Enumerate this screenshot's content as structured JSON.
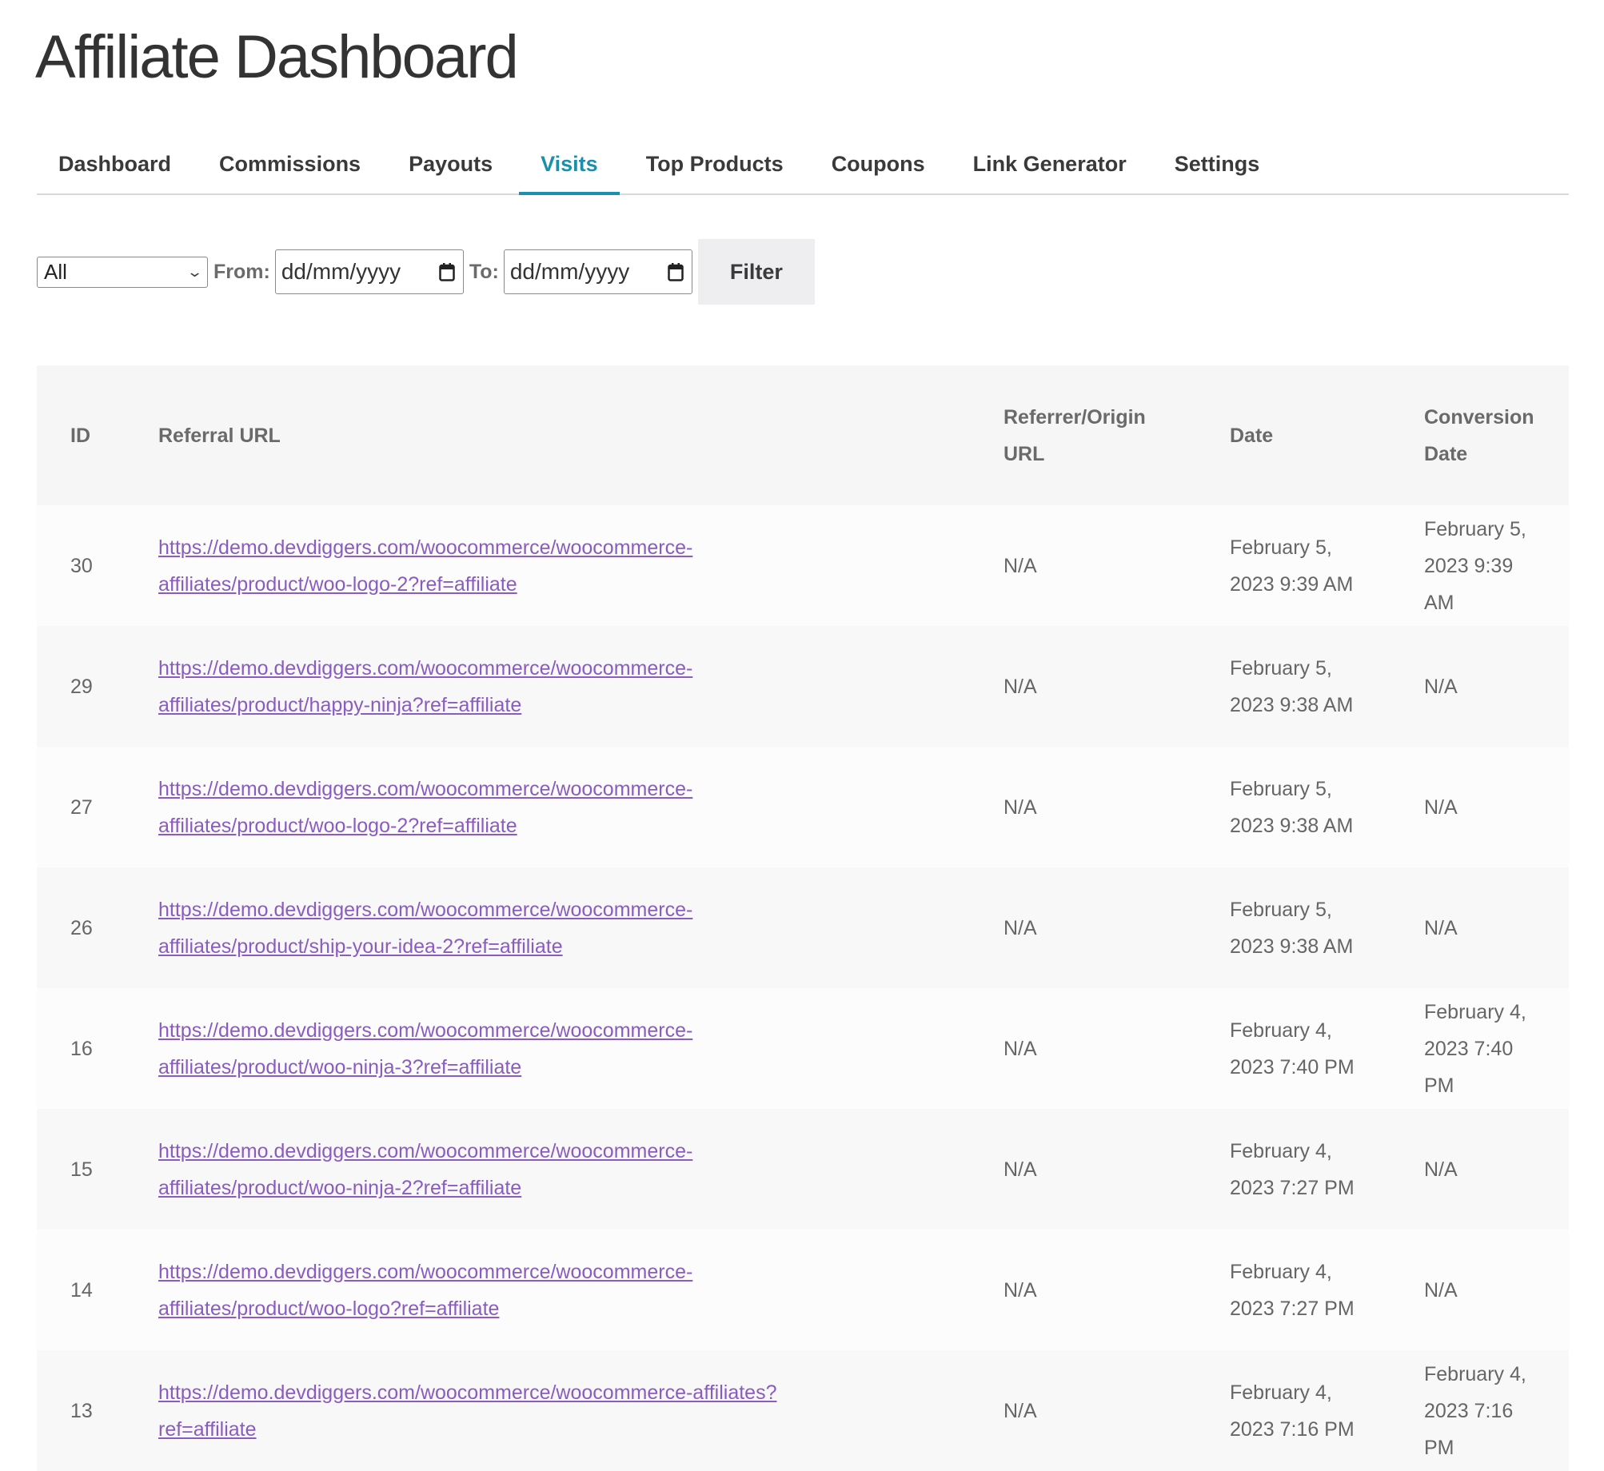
{
  "header": {
    "title": "Affiliate Dashboard"
  },
  "tabs": [
    {
      "label": "Dashboard",
      "active": false
    },
    {
      "label": "Commissions",
      "active": false
    },
    {
      "label": "Payouts",
      "active": false
    },
    {
      "label": "Visits",
      "active": true
    },
    {
      "label": "Top Products",
      "active": false
    },
    {
      "label": "Coupons",
      "active": false
    },
    {
      "label": "Link Generator",
      "active": false
    },
    {
      "label": "Settings",
      "active": false
    }
  ],
  "filters": {
    "status_select": {
      "value": "All"
    },
    "from_label": "From:",
    "from_placeholder": "dd/mm/yyyy",
    "to_label": "To:",
    "to_placeholder": "dd/mm/yyyy",
    "filter_button": "Filter"
  },
  "colors": {
    "accent": "#1a8fae",
    "link": "#8a5cc0"
  },
  "table": {
    "columns": [
      "ID",
      "Referral URL",
      "Referrer/Origin URL",
      "Date",
      "Conversion Date"
    ],
    "rows": [
      {
        "id": "30",
        "url": "https://demo.devdiggers.com/woocommerce/woocommerce-affiliates/product/woo-logo-2?ref=affiliate",
        "referrer": "N/A",
        "date": "February 5, 2023 9:39 AM",
        "conversion": "February 5, 2023 9:39 AM"
      },
      {
        "id": "29",
        "url": "https://demo.devdiggers.com/woocommerce/woocommerce-affiliates/product/happy-ninja?ref=affiliate",
        "referrer": "N/A",
        "date": "February 5, 2023 9:38 AM",
        "conversion": "N/A"
      },
      {
        "id": "27",
        "url": "https://demo.devdiggers.com/woocommerce/woocommerce-affiliates/product/woo-logo-2?ref=affiliate",
        "referrer": "N/A",
        "date": "February 5, 2023 9:38 AM",
        "conversion": "N/A"
      },
      {
        "id": "26",
        "url": "https://demo.devdiggers.com/woocommerce/woocommerce-affiliates/product/ship-your-idea-2?ref=affiliate",
        "referrer": "N/A",
        "date": "February 5, 2023 9:38 AM",
        "conversion": "N/A"
      },
      {
        "id": "16",
        "url": "https://demo.devdiggers.com/woocommerce/woocommerce-affiliates/product/woo-ninja-3?ref=affiliate",
        "referrer": "N/A",
        "date": "February 4, 2023 7:40 PM",
        "conversion": "February 4, 2023 7:40 PM"
      },
      {
        "id": "15",
        "url": "https://demo.devdiggers.com/woocommerce/woocommerce-affiliates/product/woo-ninja-2?ref=affiliate",
        "referrer": "N/A",
        "date": "February 4, 2023 7:27 PM",
        "conversion": "N/A"
      },
      {
        "id": "14",
        "url": "https://demo.devdiggers.com/woocommerce/woocommerce-affiliates/product/woo-logo?ref=affiliate",
        "referrer": "N/A",
        "date": "February 4, 2023 7:27 PM",
        "conversion": "N/A"
      },
      {
        "id": "13",
        "url": "https://demo.devdiggers.com/woocommerce/woocommerce-affiliates?ref=affiliate",
        "referrer": "N/A",
        "date": "February 4, 2023 7:16 PM",
        "conversion": "February 4, 2023 7:16 PM"
      }
    ]
  }
}
